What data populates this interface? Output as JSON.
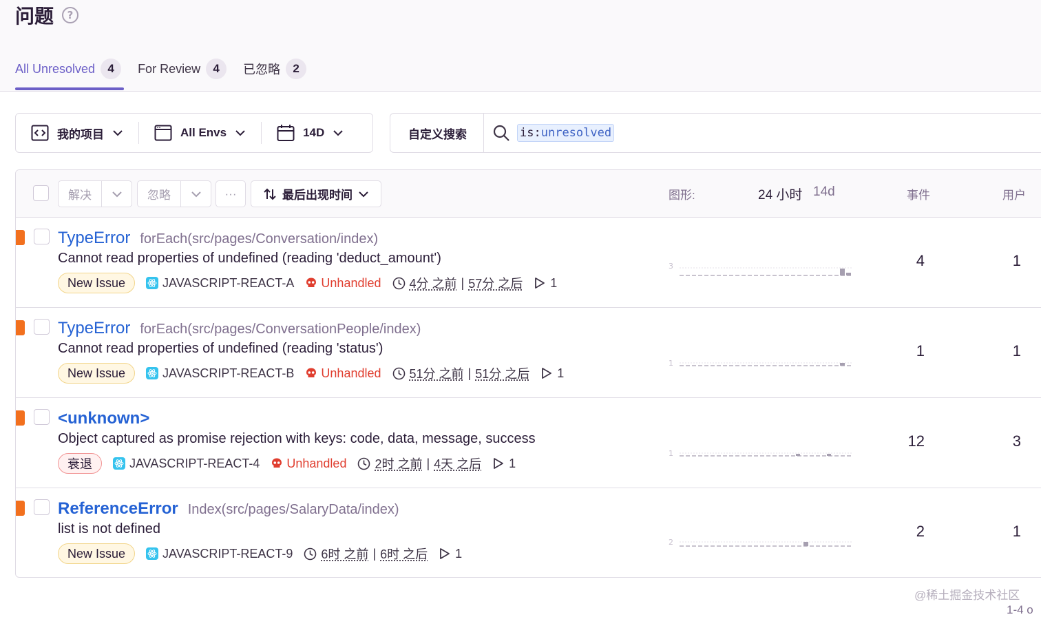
{
  "page": {
    "title": "问题",
    "help_icon": "question-circle-icon"
  },
  "tabs": [
    {
      "label": "All Unresolved",
      "count": "4",
      "active": true
    },
    {
      "label": "For Review",
      "count": "4",
      "active": false
    },
    {
      "label": "已忽略",
      "count": "2",
      "active": false
    }
  ],
  "filters": {
    "project": {
      "label": "我的项目",
      "icon": "project-code-icon"
    },
    "env": {
      "label": "All Envs",
      "icon": "window-icon"
    },
    "date": {
      "label": "14D",
      "icon": "calendar-icon"
    }
  },
  "search": {
    "saved_label": "自定义搜索",
    "token_key": "is",
    "token_sep": ":",
    "token_value": "unresolved"
  },
  "toolbar": {
    "resolve": "解决",
    "ignore": "忽略",
    "more": "···",
    "sort": "最后出现时间",
    "graph_label": "图形:",
    "period_24h": "24 小时",
    "period_14d": "14d",
    "events": "事件",
    "users": "用户"
  },
  "issues": [
    {
      "type": "TypeError",
      "culprit": "forEach(src/pages/Conversation/index)",
      "message": "Cannot read properties of undefined (reading 'deduct_amount')",
      "badge": "New Issue",
      "project": "JAVASCRIPT-REACT-A",
      "unhandled": "Unhandled",
      "first_seen": "4分 之前",
      "last_seen": "57分 之后",
      "replays": "1",
      "graph_max": "3",
      "events": "4",
      "users": "1"
    },
    {
      "type": "TypeError",
      "culprit": "forEach(src/pages/ConversationPeople/index)",
      "message": "Cannot read properties of undefined (reading 'status')",
      "badge": "New Issue",
      "project": "JAVASCRIPT-REACT-B",
      "unhandled": "Unhandled",
      "first_seen": "51分 之前",
      "last_seen": "51分 之后",
      "replays": "1",
      "graph_max": "1",
      "events": "1",
      "users": "1"
    },
    {
      "type": "<unknown>",
      "culprit": "",
      "message": "Object captured as promise rejection with keys: code, data, message, success",
      "badge": "衰退",
      "project": "JAVASCRIPT-REACT-4",
      "unhandled": "Unhandled",
      "first_seen": "2时 之前",
      "last_seen": "4天 之后",
      "replays": "1",
      "graph_max": "1",
      "events": "12",
      "users": "3"
    },
    {
      "type": "ReferenceError",
      "culprit": "Index(src/pages/SalaryData/index)",
      "message": "list is not defined",
      "badge": "New Issue",
      "project": "JAVASCRIPT-REACT-9",
      "unhandled": "",
      "first_seen": "6时 之前",
      "last_seen": "6时 之后",
      "replays": "1",
      "graph_max": "2",
      "events": "2",
      "users": "1"
    }
  ],
  "footer": {
    "watermark": "@稀土掘金技术社区",
    "pagination": "1-4 o"
  }
}
